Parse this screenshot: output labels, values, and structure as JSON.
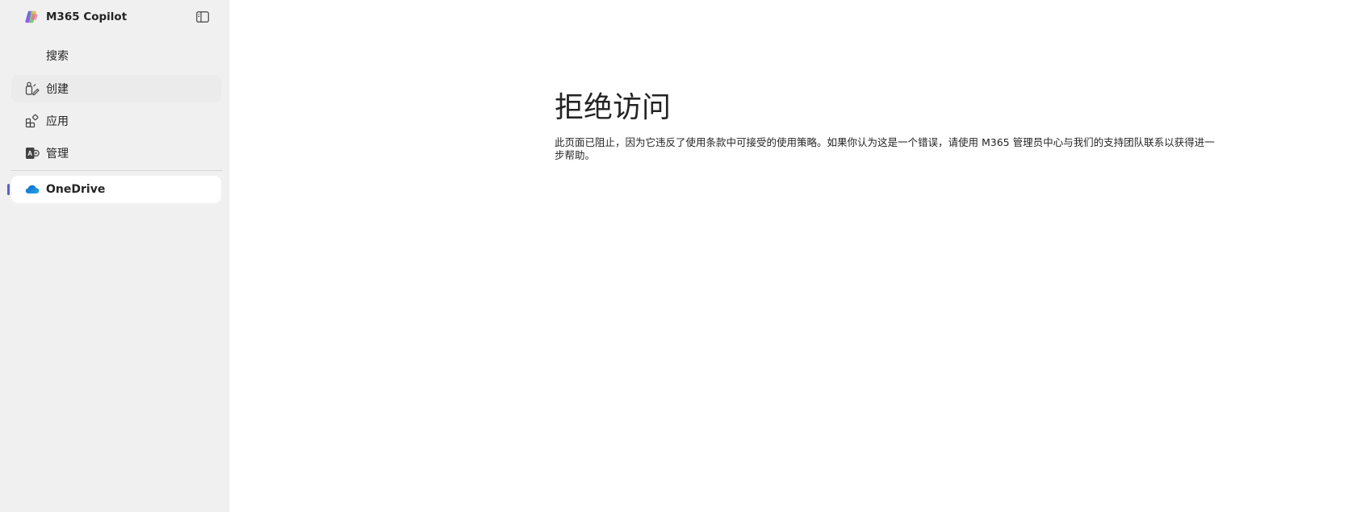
{
  "sidebar": {
    "app_title": "M365 Copilot",
    "logo_icon": "m365-copilot-logo",
    "collapse_icon": "sidebar-collapse-icon",
    "items": [
      {
        "label": "搜索",
        "icon": "search-icon",
        "state": "normal"
      },
      {
        "label": "创建",
        "icon": "create-icon",
        "state": "hover"
      },
      {
        "label": "应用",
        "icon": "apps-icon",
        "state": "normal"
      },
      {
        "label": "管理",
        "icon": "admin-icon",
        "state": "normal"
      },
      {
        "label": "OneDrive",
        "icon": "onedrive-icon",
        "state": "selected"
      }
    ],
    "selected_accent": "#5b5fc7"
  },
  "main": {
    "heading": "拒绝访问",
    "message": "此页面已阻止，因为它违反了使用条款中可接受的使用策略。如果你认为这是一个错误，请使用 M365 管理员中心与我们的支持团队联系以获得进一步帮助。"
  }
}
